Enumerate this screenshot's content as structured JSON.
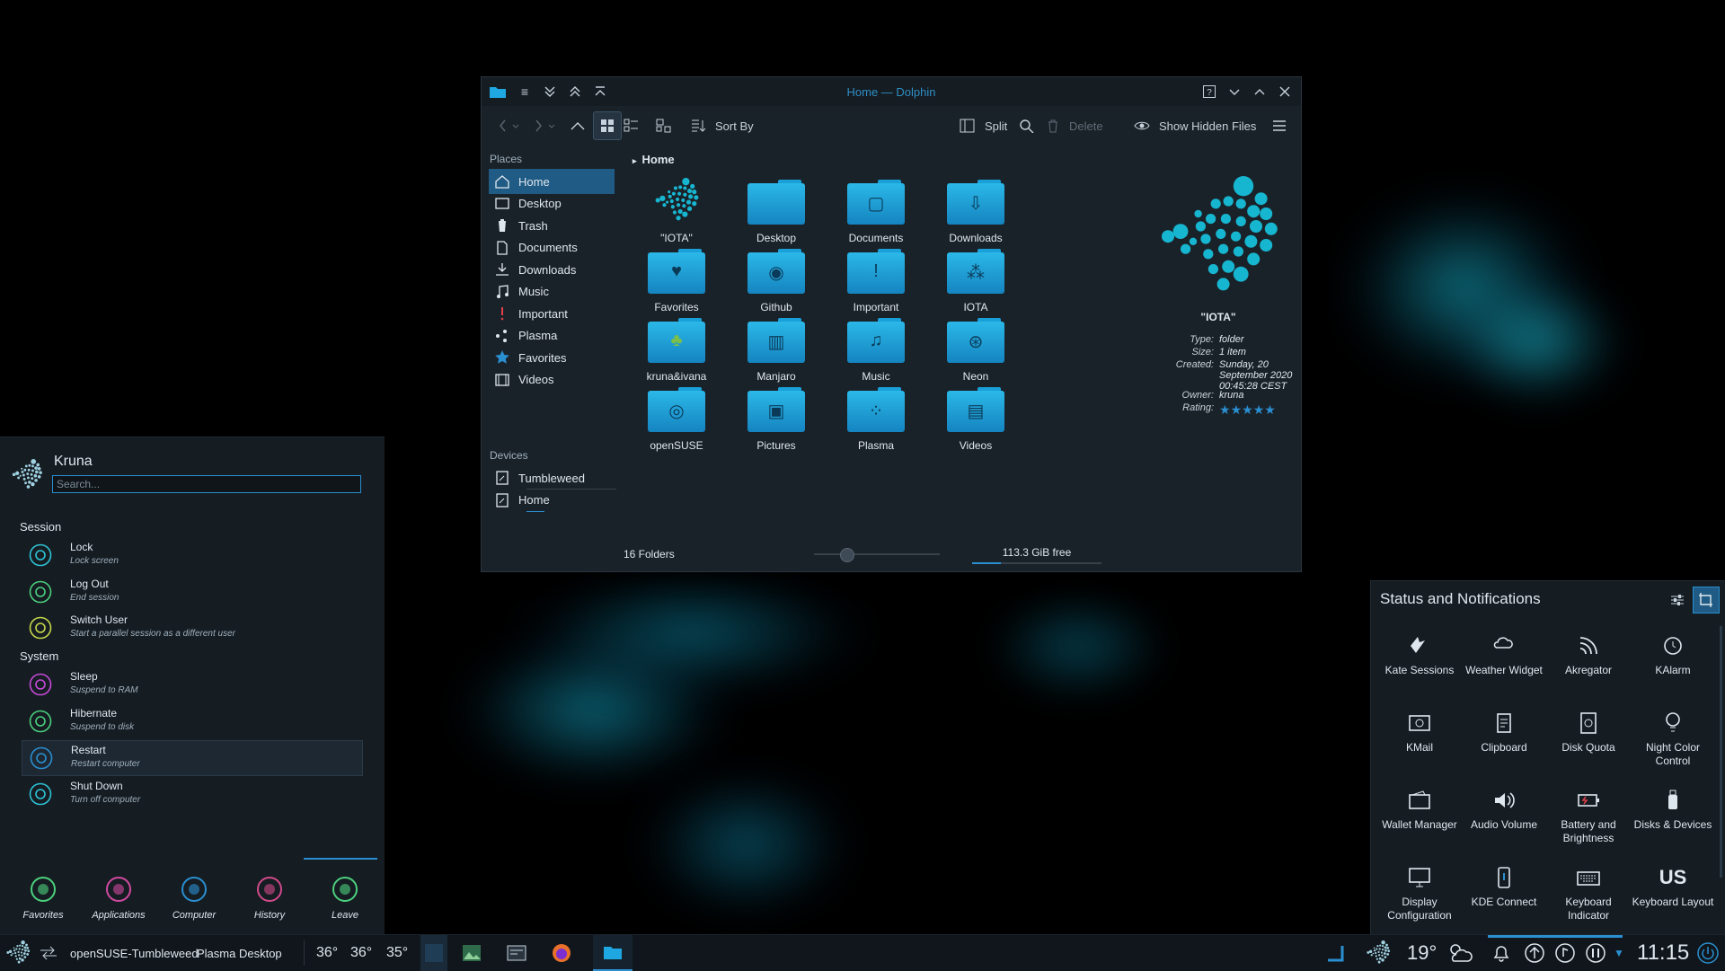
{
  "dolphin": {
    "title": "Home — Dolphin",
    "toolbar": {
      "sort_by": "Sort By",
      "split": "Split",
      "delete": "Delete",
      "show_hidden": "Show Hidden Files"
    },
    "places_heading": "Places",
    "places": [
      {
        "label": "Home",
        "icon": "home-icon",
        "selected": true
      },
      {
        "label": "Desktop",
        "icon": "desktop-icon"
      },
      {
        "label": "Trash",
        "icon": "trash-icon"
      },
      {
        "label": "Documents",
        "icon": "documents-icon"
      },
      {
        "label": "Downloads",
        "icon": "download-icon"
      },
      {
        "label": "Music",
        "icon": "music-icon"
      },
      {
        "label": "Important",
        "icon": "exclamation-icon"
      },
      {
        "label": "Plasma",
        "icon": "plasma-icon"
      },
      {
        "label": "Favorites",
        "icon": "star-icon"
      },
      {
        "label": "Videos",
        "icon": "video-icon"
      }
    ],
    "devices_heading": "Devices",
    "devices": [
      {
        "label": "Tumbleweed",
        "icon": "drive-icon"
      },
      {
        "label": "Home",
        "icon": "drive-icon"
      }
    ],
    "breadcrumb": "Home",
    "folders": [
      {
        "label": "\"IOTA\"",
        "icon": "iota-logo-icon"
      },
      {
        "label": "Desktop",
        "icon": "desktop-folder-icon"
      },
      {
        "label": "Documents",
        "icon": "documents-folder-icon"
      },
      {
        "label": "Downloads",
        "icon": "downloads-folder-icon"
      },
      {
        "label": "Favorites",
        "icon": "heart-folder-icon"
      },
      {
        "label": "Github",
        "icon": "github-folder-icon"
      },
      {
        "label": "Important",
        "icon": "important-folder-icon"
      },
      {
        "label": "IOTA",
        "icon": "iota-folder-icon"
      },
      {
        "label": "kruna&ivana",
        "icon": "chameleon-folder-icon"
      },
      {
        "label": "Manjaro",
        "icon": "manjaro-folder-icon"
      },
      {
        "label": "Music",
        "icon": "music-folder-icon"
      },
      {
        "label": "Neon",
        "icon": "neon-folder-icon"
      },
      {
        "label": "openSUSE",
        "icon": "opensuse-folder-icon"
      },
      {
        "label": "Pictures",
        "icon": "pictures-folder-icon"
      },
      {
        "label": "Plasma",
        "icon": "plasma-folder-icon"
      },
      {
        "label": "Videos",
        "icon": "videos-folder-icon"
      }
    ],
    "info": {
      "name": "\"IOTA\"",
      "rows": [
        {
          "key": "Type:",
          "value": "folder"
        },
        {
          "key": "Size:",
          "value": "1 item"
        },
        {
          "key": "Created:",
          "value": "Sunday, 20 September 2020 00:45:28 CEST"
        },
        {
          "key": "Owner:",
          "value": "kruna"
        },
        {
          "key": "Rating:",
          "value": ""
        }
      ],
      "rating_stars": 5
    },
    "status": {
      "folders": "16 Folders",
      "free": "113.3 GiB free",
      "zoom_fraction": 0.26,
      "disk_used_fraction": 0.22
    }
  },
  "kickoff": {
    "user": "Kruna",
    "search_placeholder": "Search...",
    "session_heading": "Session",
    "session": [
      {
        "title": "Lock",
        "subtitle": "Lock screen",
        "icon": "lock-icon",
        "color": "#2ec4d6"
      },
      {
        "title": "Log Out",
        "subtitle": "End session",
        "icon": "logout-icon",
        "color": "#4cd07d"
      },
      {
        "title": "Switch User",
        "subtitle": "Start a parallel session as a different user",
        "icon": "switch-user-icon",
        "color": "#c6d84a"
      }
    ],
    "system_heading": "System",
    "system": [
      {
        "title": "Sleep",
        "subtitle": "Suspend to RAM",
        "icon": "sleep-icon",
        "color": "#c64ad8"
      },
      {
        "title": "Hibernate",
        "subtitle": "Suspend to disk",
        "icon": "hibernate-icon",
        "color": "#4cd07d"
      },
      {
        "title": "Restart",
        "subtitle": "Restart computer",
        "icon": "restart-icon",
        "color": "#2a8fd0"
      },
      {
        "title": "Shut Down",
        "subtitle": "Turn off computer",
        "icon": "shutdown-icon",
        "color": "#2ec4d6"
      }
    ],
    "tabs": [
      {
        "label": "Favorites",
        "icon": "favorites-icon",
        "color": "#4cd07d"
      },
      {
        "label": "Applications",
        "icon": "applications-icon",
        "color": "#d04aa0"
      },
      {
        "label": "Computer",
        "icon": "computer-icon",
        "color": "#2a8fd0"
      },
      {
        "label": "History",
        "icon": "history-icon",
        "color": "#d04a8a"
      },
      {
        "label": "Leave",
        "icon": "leave-icon",
        "color": "#4cd07d"
      }
    ]
  },
  "notifications": {
    "title": "Status and Notifications",
    "items": [
      {
        "label": "Kate Sessions",
        "icon": "kate-icon"
      },
      {
        "label": "Weather Widget",
        "icon": "weather-icon"
      },
      {
        "label": "Akregator",
        "icon": "rss-icon"
      },
      {
        "label": "KAlarm",
        "icon": "alarm-icon"
      },
      {
        "label": "KMail",
        "icon": "mail-icon"
      },
      {
        "label": "Clipboard",
        "icon": "clipboard-icon"
      },
      {
        "label": "Disk Quota",
        "icon": "disk-quota-icon"
      },
      {
        "label": "Night Color Control",
        "icon": "night-color-icon"
      },
      {
        "label": "Wallet Manager",
        "icon": "wallet-icon"
      },
      {
        "label": "Audio Volume",
        "icon": "speaker-icon"
      },
      {
        "label": "Battery and Brightness",
        "icon": "battery-icon"
      },
      {
        "label": "Disks & Devices",
        "icon": "usb-drive-icon"
      },
      {
        "label": "Display Configuration",
        "icon": "display-icon"
      },
      {
        "label": "KDE Connect",
        "icon": "phone-icon"
      },
      {
        "label": "Keyboard Indicator",
        "icon": "keyboard-icon"
      },
      {
        "label": "Keyboard Layout",
        "icon": "keyboard-layout-text",
        "text": "us"
      }
    ]
  },
  "panel": {
    "pager_label": "openSUSE-Tumbleweed",
    "activity_label": "Plasma Desktop",
    "temps": [
      "36°",
      "36°",
      "35°"
    ],
    "weather_temp": "19°",
    "clock": "11:15"
  },
  "colors": {
    "accent": "#2a8fd0",
    "folder_top": "#2bb8e8",
    "folder_bottom": "#1584c0",
    "iota_dots": "#17b6d0"
  }
}
